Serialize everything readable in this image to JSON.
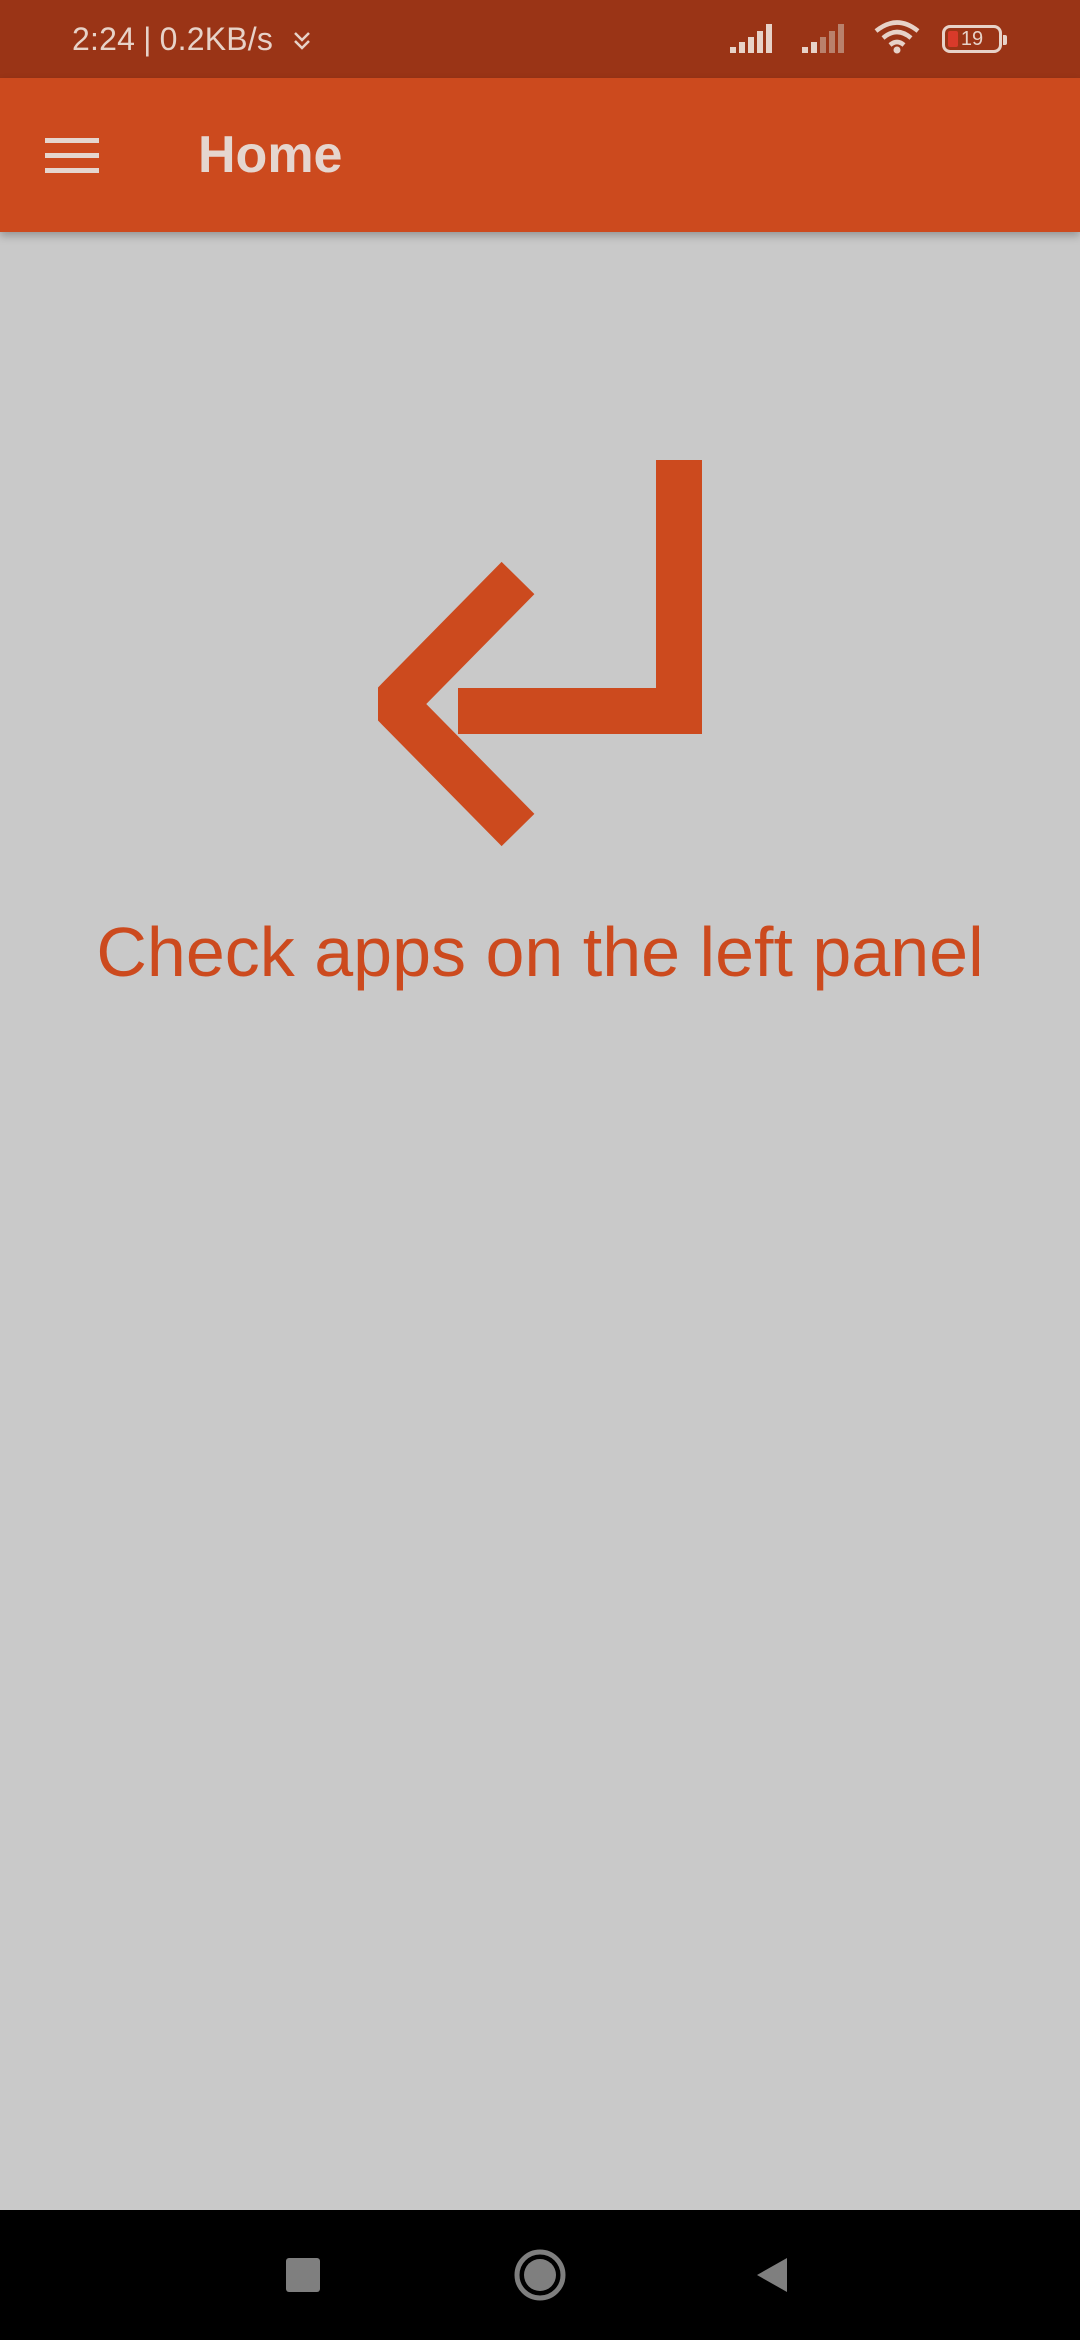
{
  "status_bar": {
    "time": "2:24",
    "separator": "|",
    "network_speed": "0.2KB/s",
    "battery_level": "19",
    "icons": [
      "download-icon",
      "signal-icon",
      "signal-icon",
      "wifi-icon",
      "battery-icon"
    ]
  },
  "app_bar": {
    "title": "Home",
    "menu_icon": "menu-icon"
  },
  "main": {
    "hint_text": "Check apps on the left panel",
    "arrow_icon": "return-arrow-icon"
  },
  "nav_bar": {
    "icons": [
      "recent-apps-icon",
      "home-icon",
      "back-icon"
    ]
  },
  "colors": {
    "accent": "#cc4a1e",
    "status_bar": "#9a3416",
    "background": "#c9c9c9",
    "nav_bar": "#000000"
  }
}
